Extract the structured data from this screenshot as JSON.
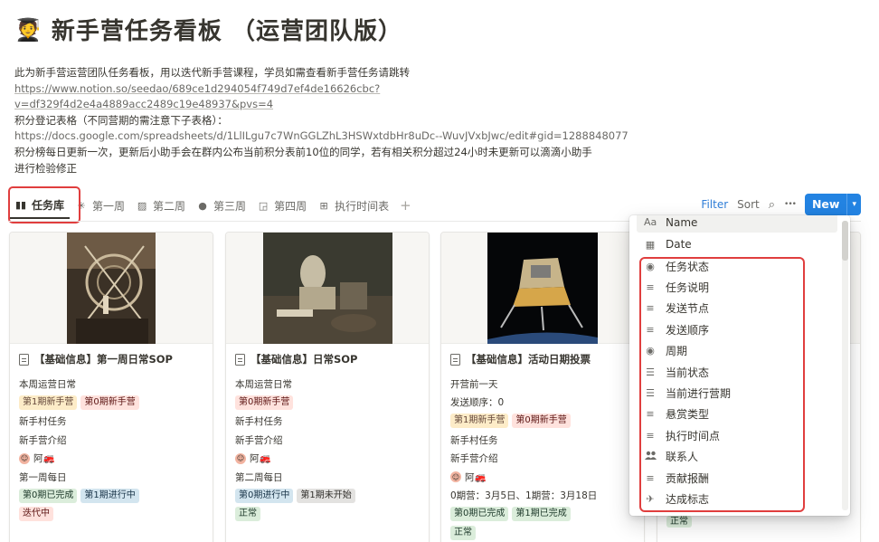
{
  "page": {
    "icon": "🧑‍🎓",
    "title": "新手营任务看板 （运营团队版）",
    "description": {
      "line1": "此为新手营运营团队任务看板，用以迭代新手营课程，学员如需查看新手营任务请跳转",
      "link1a": "https://www.notion.so/seedao/689ce1d294054f749d7ef4de16626cbc?",
      "link1b": "v=df329f4d2e4a4889acc2489c19e48937&pvs=4",
      "line2": "积分登记表格（不同营期的需注意下子表格）：",
      "link2": "https://docs.google.com/spreadsheets/d/1LlILgu7c7WnGGLZhL3HSWxtdbHr8uDc--WuvJVxbJwc/edit#gid=1288848077",
      "line3": "积分榜每日更新一次，更新后小助手会在群内公布当前积分表前10位的同学，若有相关积分超过24小时未更新可以滴滴小助手",
      "line4": "进行检验修正"
    }
  },
  "tabs": [
    {
      "label": "任务库",
      "icon": "book-icon",
      "glyph": "▮▮"
    },
    {
      "label": "第一周",
      "icon": "sparkle-icon",
      "glyph": "✳"
    },
    {
      "label": "第二周",
      "icon": "image-icon",
      "glyph": "▨"
    },
    {
      "label": "第三周",
      "icon": "apple-icon",
      "glyph": "●"
    },
    {
      "label": "第四周",
      "icon": "chart-icon",
      "glyph": "◲"
    },
    {
      "label": "执行时间表",
      "icon": "table-icon",
      "glyph": "⊞"
    }
  ],
  "toolbar": {
    "filter": "Filter",
    "sort": "Sort",
    "new": "New",
    "search_glyph": "⌕",
    "more_glyph": "•••",
    "chevron_glyph": "▾",
    "plus_glyph": "+"
  },
  "cards": [
    {
      "title": "【基础信息】第一周日常SOP",
      "rows": [
        {
          "text": "本周运营日常"
        },
        {
          "tags": [
            {
              "t": "第1期新手营",
              "c": "yellow"
            },
            {
              "t": "第0期新手营",
              "c": "red"
            }
          ]
        },
        {
          "text": "新手村任务"
        },
        {
          "text": "新手营介绍"
        },
        {
          "person": "阿🚒"
        },
        {
          "text": "第一周每日"
        },
        {
          "tags": [
            {
              "t": "第0期已完成",
              "c": "green"
            },
            {
              "t": "第1期进行中",
              "c": "blue"
            }
          ]
        },
        {
          "tags": [
            {
              "t": "迭代中",
              "c": "red"
            }
          ]
        }
      ]
    },
    {
      "title": "【基础信息】日常SOP",
      "rows": [
        {
          "text": "本周运营日常"
        },
        {
          "tags": [
            {
              "t": "第0期新手营",
              "c": "red"
            }
          ]
        },
        {
          "text": "新手村任务"
        },
        {
          "text": "新手营介绍"
        },
        {
          "person": "阿🚒"
        },
        {
          "text": "第二周每日"
        },
        {
          "tags": [
            {
              "t": "第0期进行中",
              "c": "blue"
            },
            {
              "t": "第1期未开始",
              "c": "gray"
            }
          ]
        },
        {
          "tags": [
            {
              "t": "正常",
              "c": "green"
            }
          ]
        }
      ]
    },
    {
      "title": "【基础信息】活动日期投票",
      "rows": [
        {
          "text": "开营前一天"
        },
        {
          "text": "发送顺序：0"
        },
        {
          "tags": [
            {
              "t": "第1期新手营",
              "c": "yellow"
            },
            {
              "t": "第0期新手营",
              "c": "red"
            }
          ]
        },
        {
          "text": "新手村任务"
        },
        {
          "text": "新手营介绍"
        },
        {
          "person": "阿🚒"
        },
        {
          "text": "0期营：3月5日、1期营：3月18日"
        },
        {
          "tags": [
            {
              "t": "第0期已完成",
              "c": "green"
            },
            {
              "t": "第1期已完成",
              "c": "green"
            }
          ]
        },
        {
          "tags": [
            {
              "t": "正常",
              "c": "green"
            }
          ]
        }
      ]
    }
  ],
  "card4_tag": "正常",
  "properties": [
    {
      "label": "Name",
      "icon": "text-type-icon",
      "glyph": "Aa"
    },
    {
      "label": "Date",
      "icon": "calendar-icon",
      "glyph": "▦"
    },
    {
      "label": "任务状态",
      "icon": "status-icon",
      "glyph": "◉"
    },
    {
      "label": "任务说明",
      "icon": "text-icon",
      "glyph": "≡"
    },
    {
      "label": "发送节点",
      "icon": "text-icon",
      "glyph": "≡"
    },
    {
      "label": "发送顺序",
      "icon": "text-icon",
      "glyph": "≡"
    },
    {
      "label": "周期",
      "icon": "status-icon",
      "glyph": "◉"
    },
    {
      "label": "当前状态",
      "icon": "list-icon",
      "glyph": "☰"
    },
    {
      "label": "当前进行营期",
      "icon": "list-icon",
      "glyph": "☰"
    },
    {
      "label": "悬赏类型",
      "icon": "text-icon",
      "glyph": "≡"
    },
    {
      "label": "执行时间点",
      "icon": "text-icon",
      "glyph": "≡"
    },
    {
      "label": "联系人",
      "icon": "people-icon",
      "glyph": "👥"
    },
    {
      "label": "贡献报酬",
      "icon": "text-icon",
      "glyph": "≡"
    },
    {
      "label": "达成标志",
      "icon": "airplane-icon",
      "glyph": "✈"
    }
  ]
}
